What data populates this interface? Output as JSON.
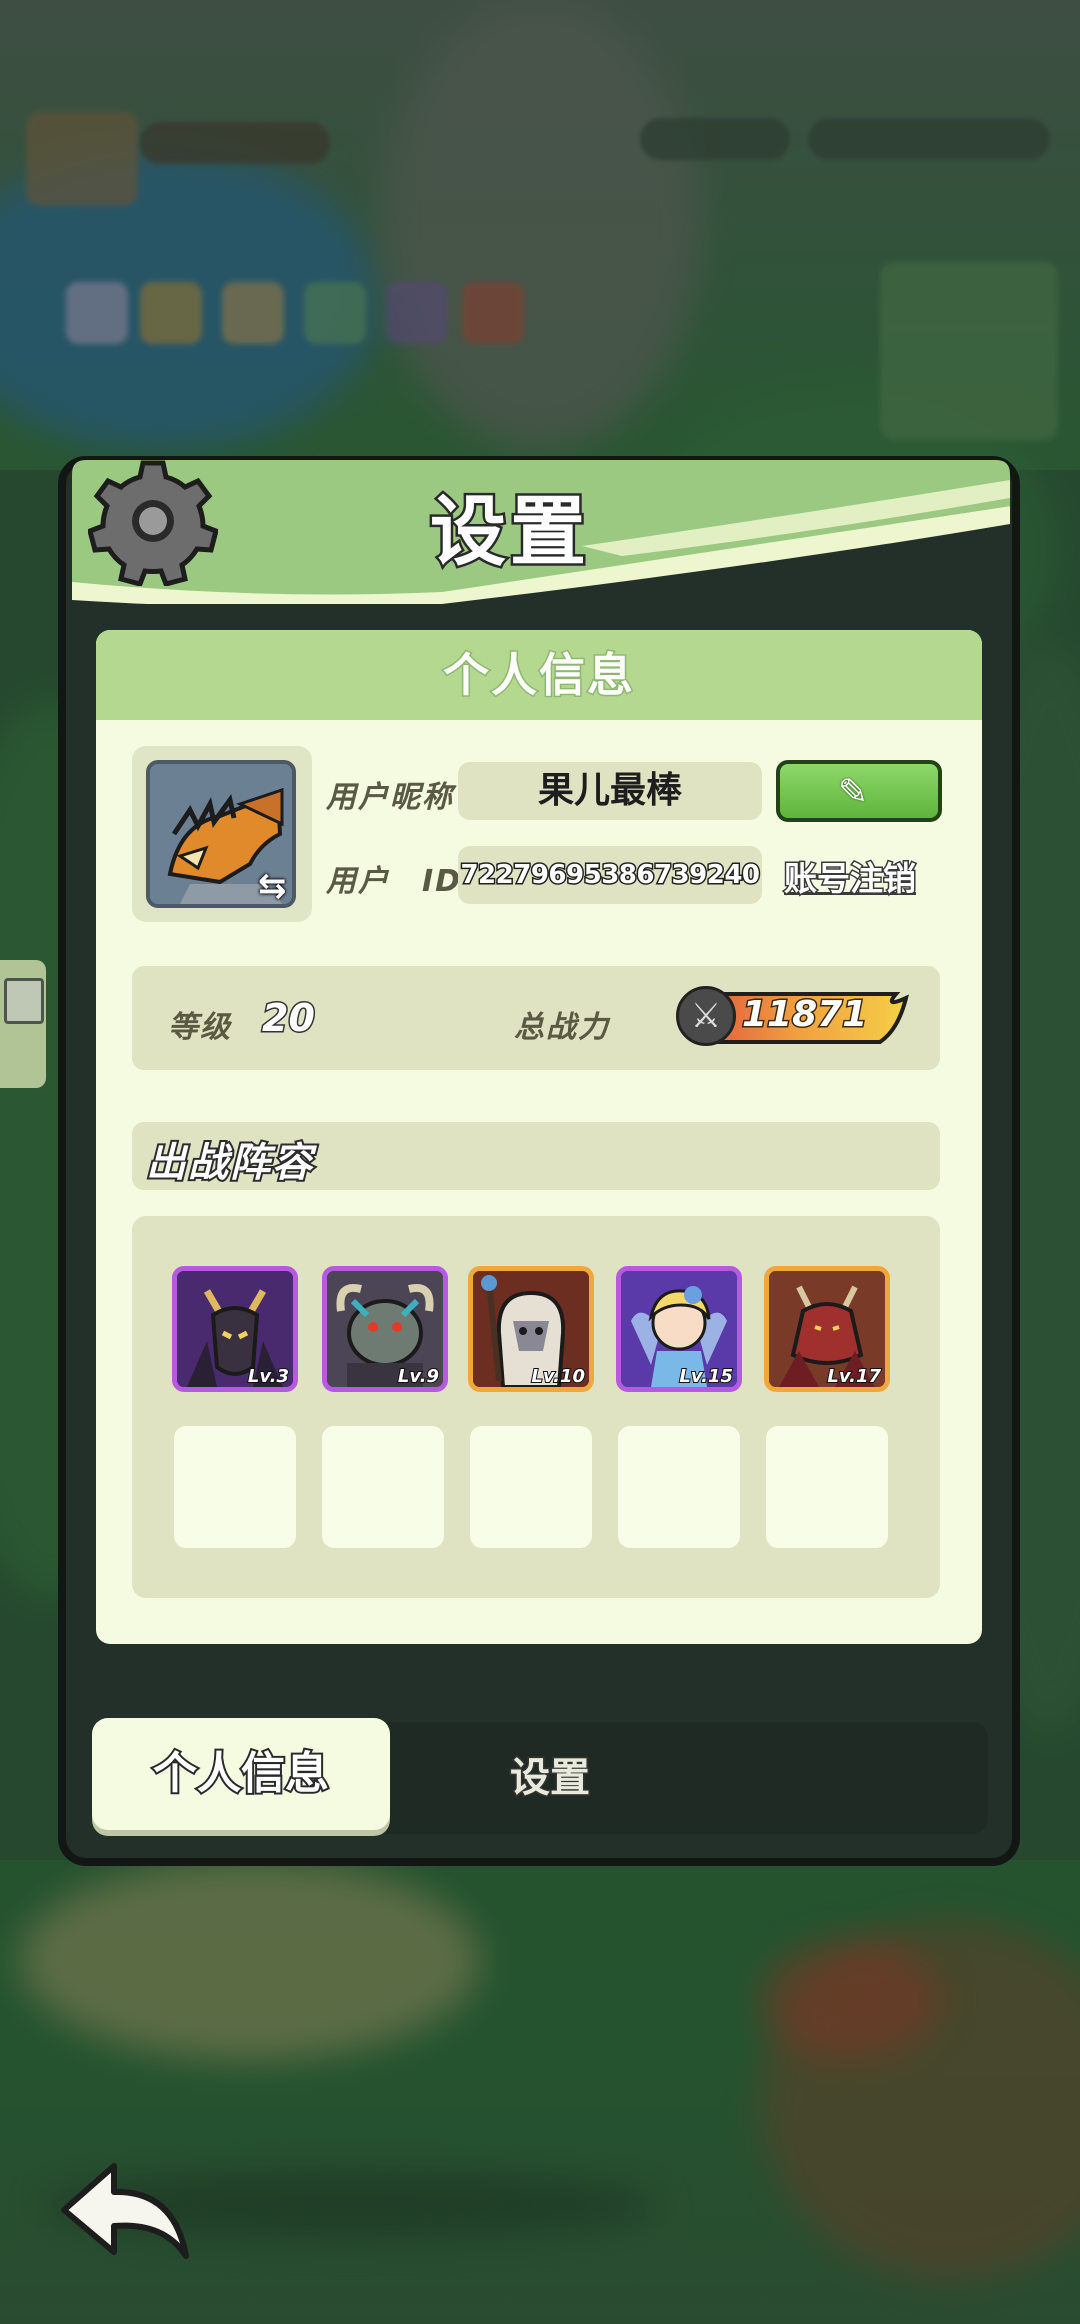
{
  "panel": {
    "title": "设置",
    "info_card_title": "个人信息"
  },
  "profile": {
    "nickname_label": "用户昵称",
    "nickname_value": "果儿最棒",
    "id_label": "用户　ID",
    "id_value": "72279695386739240",
    "account_cancel": "账号注销",
    "edit_icon": "pencil-icon",
    "avatar_swap_icon": "swap-icon"
  },
  "stats": {
    "level_label": "等级",
    "level_value": "20",
    "power_label": "总战力",
    "power_value": "11871"
  },
  "lineup": {
    "title": "出战阵容",
    "heroes": [
      {
        "level": "Lv.3",
        "frame": "purple"
      },
      {
        "level": "Lv.9",
        "frame": "purple"
      },
      {
        "level": "Lv.10",
        "frame": "orange"
      },
      {
        "level": "Lv.15",
        "frame": "purple"
      },
      {
        "level": "Lv.17",
        "frame": "orange"
      }
    ],
    "empty_slots": 5
  },
  "tabs": {
    "active": "个人信息",
    "inactive": "设置"
  },
  "colors": {
    "header_green": "#b4d890",
    "card_bg": "#f4fbe1",
    "field_bg": "#dfe3c2",
    "edit_green": "#6fc24a",
    "purple_frame": "#b65adf",
    "orange_frame": "#f0a83a"
  }
}
